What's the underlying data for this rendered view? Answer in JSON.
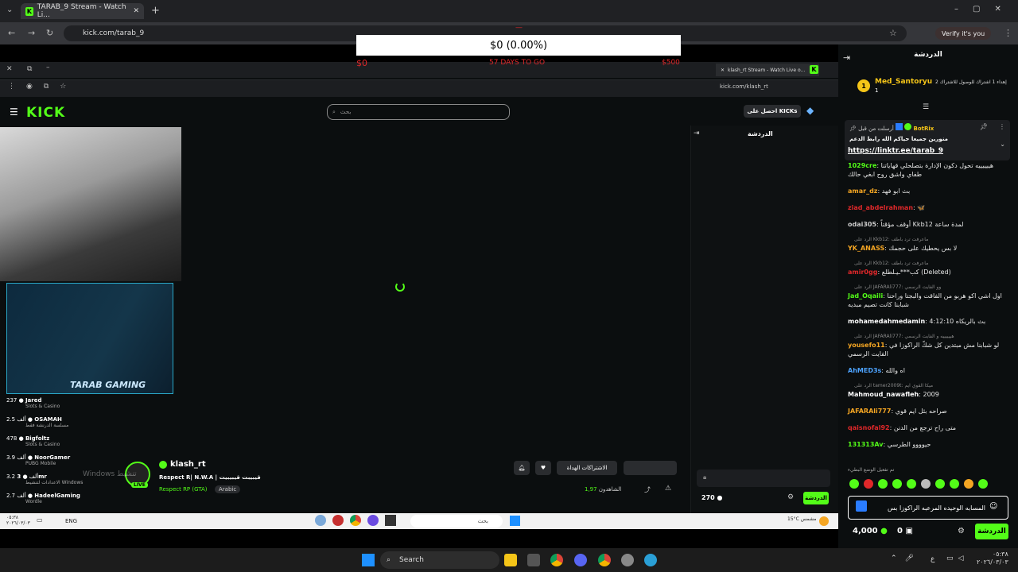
{
  "outer_browser": {
    "tab_title": "TARAB_9 Stream - Watch Li...",
    "url": "kick.com/tarab_9",
    "verify_label": "Verify it's you"
  },
  "donation_goal": {
    "amount": "$0 (0.00%)",
    "start": "$0",
    "days_left": "57 DAYS TO GO",
    "target": "$500",
    "progress_fraction": 0.0
  },
  "inner_browser": {
    "tab_title": "klash_rt Stream - Watch Live o...",
    "url": "kick.com/klash_rt"
  },
  "kick": {
    "logo": "KICK",
    "search_placeholder": "بحث",
    "get_kicks": "احصل على KICKs",
    "chat_title": "الدردشة"
  },
  "webcam_brand": "TARAB GAMING",
  "leaderboard": [
    {
      "count": "237",
      "name": "Jared",
      "sub": "Slots & Casino"
    },
    {
      "count": "2.5 ألف",
      "name": "OSAMAH",
      "sub": "مسلسة الدرنشة فقط"
    },
    {
      "count": "478",
      "name": "Bigfoltz",
      "sub": "Slots & Casino"
    },
    {
      "count": "3.9 ألف",
      "name": "NoorGamer",
      "sub": "PUBG Mobile"
    },
    {
      "count": "3.2 ألف",
      "name": "3mr",
      "sub": "الاعدادات لتنشيط Windows"
    },
    {
      "count": "2.7 ألف",
      "name": "HadeelGaming",
      "sub": "Wordle"
    }
  ],
  "watermark": "Windows تنشيط",
  "streamer": {
    "name": "klash_rt",
    "title": "Respect R| N.W.A | قيبيبت قيبيبيت",
    "category": "Respect RP (GTA)",
    "language": "Arabic",
    "live_badge": "LIVE",
    "subscribe_label": "الاشتراكات الهداة",
    "viewers": "1,97",
    "viewers_label": "الشاهدون"
  },
  "inner_chat": {
    "kicks": "270",
    "chat_button": "الدردشة"
  },
  "inner_taskbar": {
    "search": "بحث",
    "lang": "ENG",
    "weather": "15°C مشمس",
    "time": "٠٥:٣٨",
    "date": "٢٠٢٦/٠٣/٠٣"
  },
  "right_chat": {
    "title": "الدردشة",
    "top_gifter": {
      "rank": "1",
      "name": "Med_Santoryu",
      "count": "1",
      "text": "إهداء 1 اشتراك للوصول للاشتراك 2"
    },
    "pinned": {
      "user": "BotRix",
      "sent_by": "أرسلت من قبل",
      "text": "منورين جميعا حياكم الله رابط الدعم",
      "link": "https://linktr.ee/tarab_9"
    },
    "messages": [
      {
        "user": "1029cre",
        "color": "#53fc18",
        "text": "هييييييه تحول دكون الإدارة بتصلحلي قهاياتنا طفاي واشق روح ابغي حالك",
        "reply": ""
      },
      {
        "user": "amar_dz",
        "color": "#f5a623",
        "text": "بث ابو فهد",
        "reply": ""
      },
      {
        "user": "ziad_abdelrahman",
        "color": "#e0282a",
        "text": "🦋",
        "reply": ""
      },
      {
        "user": "odai305",
        "color": "#cccccc",
        "text": "أوقف مؤقتاً Kkb12 لمدة ساعة",
        "reply": ""
      },
      {
        "user": "YK_ANASS",
        "color": "#f5a623",
        "text": "لا بس يحطيك على حجمك",
        "reply": "الرد على Kkb12: ماعرفت ترد باطف"
      },
      {
        "user": "amir0gg",
        "color": "#e0282a",
        "text": "كب***ـيـلطلع (Deleted)",
        "reply": "الرد على Kkb12: ماعرفت ترد باطف"
      },
      {
        "user": "Jad_Oqaili",
        "color": "#53fc18",
        "text": "اول اشي اكو هربو من الفاقت والبجتا وراحنا شبابنا كانت تصيم مبديه",
        "reply": "الرد على JAFARAli777: وو الفايت الرسمي"
      },
      {
        "user": "mohamedahmedamin",
        "color": "#ffffff",
        "text": "بث بالريكاه 4:12:10",
        "reply": ""
      },
      {
        "user": "yousefo11",
        "color": "#f5a623",
        "text": "لو شبابنا مش مبتدين كل شكّ الراكوزا في الفايت الرسمي",
        "reply": "الرد على JAFARAli777: هييييييه و الفايت الرسمي"
      },
      {
        "user": "AhMED3s",
        "color": "#4da3ff",
        "text": "اه والله",
        "reply": ""
      },
      {
        "user": "Mahmoud_nawafleh",
        "color": "#ffffff",
        "text": "2009",
        "reply": "الرد على tamer2009t: ميكا القوي ايم"
      },
      {
        "user": "JAFARAli777",
        "color": "#f5a623",
        "text": "صراحه بثل ايم قوي",
        "reply": ""
      },
      {
        "user": "qaisnofal92",
        "color": "#e0282a",
        "text": "متى راح ترجع من الدنن",
        "reply": ""
      },
      {
        "user": "131313Av",
        "color": "#53fc18",
        "text": "حيوووو الطرسي",
        "reply": ""
      }
    ],
    "slow_mode": "تم تفعيل الوضع البطيء",
    "input_text": "المسابه الوحيده المرعبه الراكوزا بس",
    "kicks": "4,000",
    "kicks2": "0",
    "chat_button": "الدردشة"
  },
  "taskbar": {
    "search": "Search",
    "time": "٠٥:٣٨",
    "date": "٢٠٢٦/٠٣/٠٣",
    "lang": "ع"
  }
}
